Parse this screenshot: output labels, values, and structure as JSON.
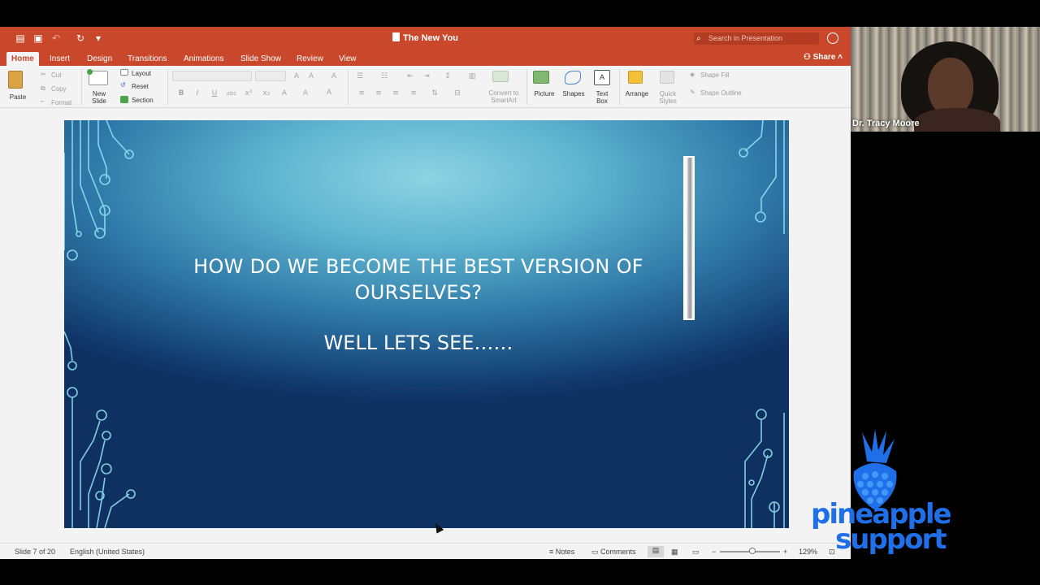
{
  "app": {
    "doc_title": "The New You",
    "search_placeholder": "Search in Presentation",
    "share_label": "Share"
  },
  "tabs": [
    {
      "label": "Home",
      "active": true
    },
    {
      "label": "Insert"
    },
    {
      "label": "Design"
    },
    {
      "label": "Transitions"
    },
    {
      "label": "Animations"
    },
    {
      "label": "Slide Show"
    },
    {
      "label": "Review"
    },
    {
      "label": "View"
    }
  ],
  "ribbon": {
    "paste": "Paste",
    "cut": "Cut",
    "copy": "Copy",
    "format": "Format",
    "new_slide_l1": "New",
    "new_slide_l2": "Slide",
    "layout": "Layout",
    "reset": "Reset",
    "section": "Section",
    "convert_l1": "Convert to",
    "convert_l2": "SmartArt",
    "picture": "Picture",
    "shapes": "Shapes",
    "textbox_l1": "Text",
    "textbox_l2": "Box",
    "arrange": "Arrange",
    "quick_l1": "Quick",
    "quick_l2": "Styles",
    "shape_fill": "Shape Fill",
    "shape_outline": "Shape Outline"
  },
  "slide": {
    "title_line1": "HOW DO WE BECOME THE BEST VERSION OF",
    "title_line2": "OURSELVES?",
    "subtitle": "WELL LETS SEE……"
  },
  "status": {
    "slide_counter": "Slide 7 of 20",
    "language": "English (United States)",
    "notes": "Notes",
    "comments": "Comments",
    "zoom": "129%"
  },
  "video": {
    "participant_name": "Dr. Tracy Moore"
  },
  "logo": {
    "line1": "pineapple",
    "line2": "support"
  },
  "colors": {
    "accent": "#c9472b",
    "logo_blue": "#1f6fe8"
  }
}
